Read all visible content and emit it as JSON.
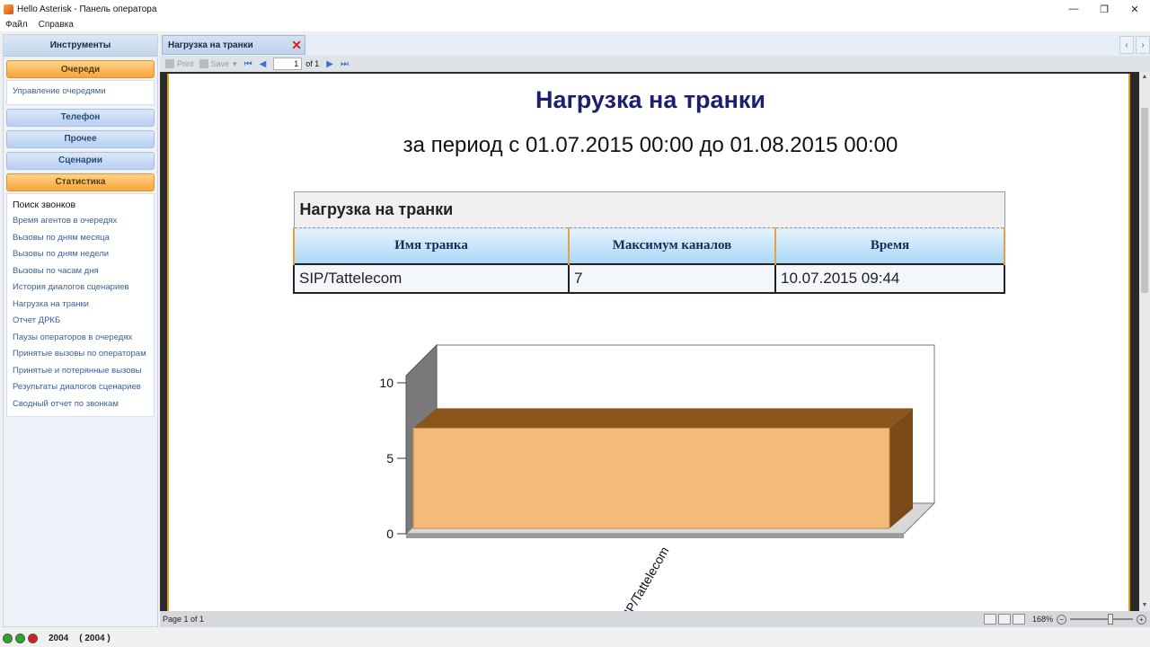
{
  "window": {
    "title": "Hello Asterisk - Панель оператора",
    "minimize": "—",
    "restore": "❐",
    "close": "✕"
  },
  "menu": [
    "Файл",
    "Справка"
  ],
  "sidebar": {
    "header": "Инструменты",
    "groups": {
      "queues": "Очереди",
      "queues_items": [
        "Управление очередями"
      ],
      "phone": "Телефон",
      "other": "Прочее",
      "scenarios": "Сценарии",
      "stats": "Статистика",
      "stats_items": [
        "Поиск звонков",
        "Время агентов в очередях",
        "Вызовы по дням месяца",
        "Вызовы по дням недели",
        "Вызовы по часам дня",
        "История диалогов сценариев",
        "Нагрузка на транки",
        "Отчет ДРКБ",
        "Паузы операторов в очередях",
        "Принятые вызовы по операторам",
        "Принятые и потерянные вызовы",
        "Результаты диалогов сценариев",
        "Сводный отчет по звонкам"
      ]
    }
  },
  "tabs": {
    "active": "Нагрузка на транки",
    "close": "✕",
    "prev": "‹",
    "next": "›"
  },
  "toolbar": {
    "print": "Print",
    "save": "Save",
    "page": "1",
    "of": "of 1"
  },
  "report": {
    "title": "Нагрузка на транки",
    "subtitle": "за период с 01.07.2015 00:00 до 01.08.2015 00:00",
    "table": {
      "caption": "Нагрузка на транки",
      "headers": [
        "Имя транка",
        "Максимум каналов",
        "Время"
      ],
      "rows": [
        [
          "SIP/Tattelecom",
          "7",
          "10.07.2015 09:44"
        ]
      ]
    }
  },
  "chart_data": {
    "type": "bar",
    "categories": [
      "SIP/Tattelecom"
    ],
    "values": [
      7
    ],
    "ylim": [
      0,
      10
    ],
    "yticks": [
      "10",
      "5",
      "0"
    ],
    "bar_color": "#f5b97a",
    "bar_side_color": "#7a4a18",
    "bar_top_color": "#8a561c"
  },
  "status": {
    "page": "Page 1 of 1",
    "zoom": "168%"
  },
  "bottom": {
    "extension": "2004",
    "extension_paren": "( 2004 )"
  }
}
